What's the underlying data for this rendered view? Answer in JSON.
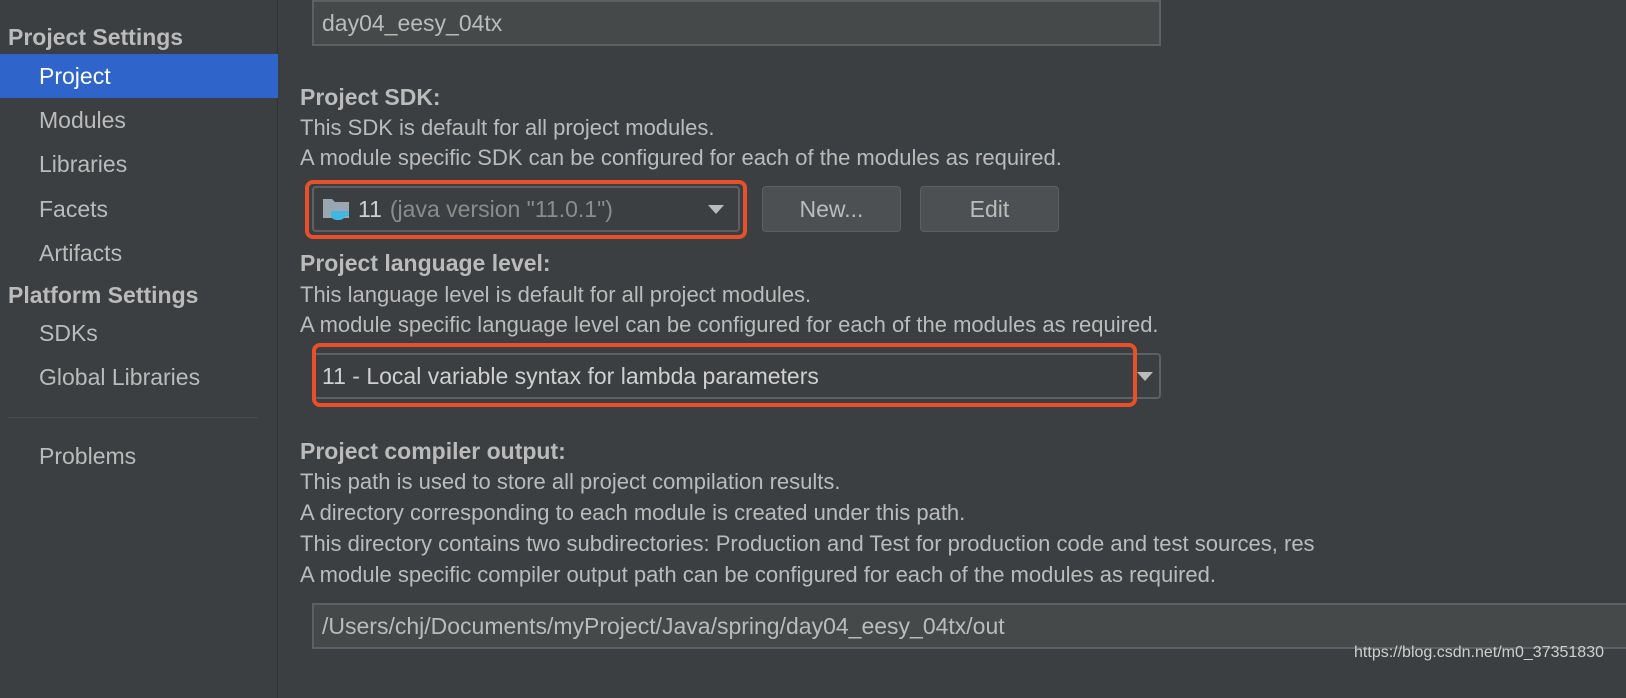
{
  "sidebar": {
    "project_settings": "Project Settings",
    "items": [
      "Project",
      "Modules",
      "Libraries",
      "Facets",
      "Artifacts"
    ],
    "platform_settings": "Platform Settings",
    "platform_items": [
      "SDKs",
      "Global Libraries"
    ],
    "problems": "Problems"
  },
  "main": {
    "project_name": "day04_eesy_04tx",
    "sdk": {
      "heading": "Project SDK:",
      "line1": "This SDK is default for all project modules.",
      "line2": "A module specific SDK can be configured for each of the modules as required.",
      "selected_version": "11",
      "selected_detail": "(java version \"11.0.1\")",
      "new_label": "New...",
      "edit_label": "Edit"
    },
    "language": {
      "heading": "Project language level:",
      "line1": "This language level is default for all project modules.",
      "line2": "A module specific language level can be configured for each of the modules as required.",
      "selected": "11 - Local variable syntax for lambda parameters"
    },
    "compiler": {
      "heading": "Project compiler output:",
      "line1": "This path is used to store all project compilation results.",
      "line2": "A directory corresponding to each module is created under this path.",
      "line3": "This directory contains two subdirectories: Production and Test for production code and test sources, res",
      "line4": "A module specific compiler output path can be configured for each of the modules as required.",
      "path": "/Users/chj/Documents/myProject/Java/spring/day04_eesy_04tx/out"
    }
  },
  "watermark": "https://blog.csdn.net/m0_37351830",
  "colors": {
    "selection": "#2f65ca",
    "highlight": "#e8502a"
  }
}
